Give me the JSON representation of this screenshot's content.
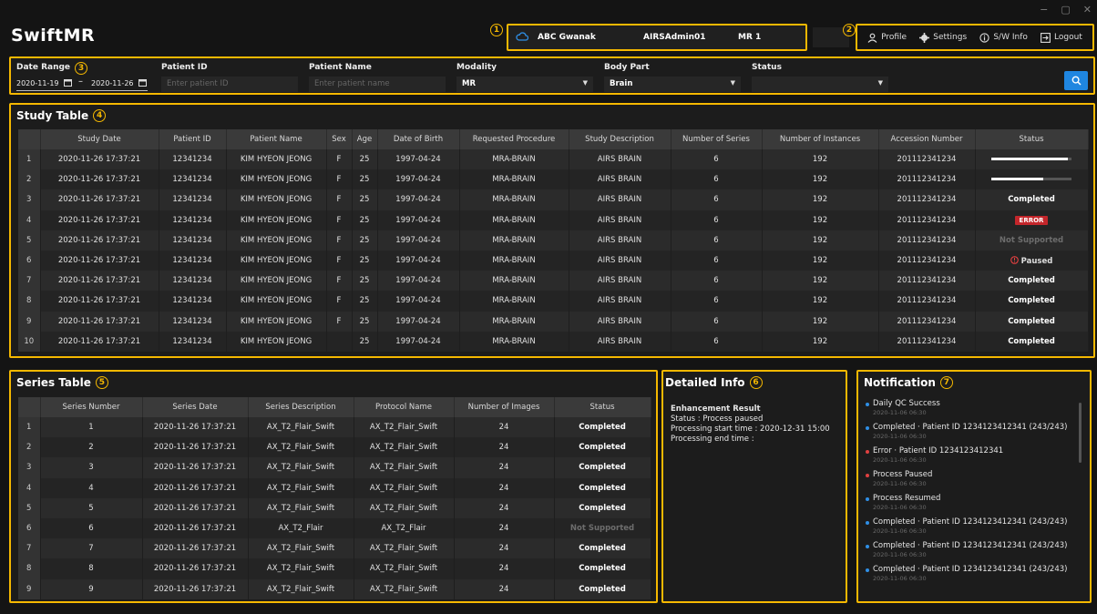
{
  "window": {
    "minimize": "−",
    "maximize": "▢",
    "close": "✕"
  },
  "app": {
    "title": "SwiftMR"
  },
  "badges": {
    "b1": "1",
    "b2": "2",
    "b3": "3",
    "b4": "4",
    "b5": "5",
    "b6": "6",
    "b7": "7"
  },
  "header": {
    "site": "ABC Gwanak",
    "user": "AIRSAdmin01",
    "device": "MR 1"
  },
  "menu": {
    "profile": "Profile",
    "settings": "Settings",
    "swinfo": "S/W Info",
    "logout": "Logout"
  },
  "filters": {
    "date_range_label": "Date Range",
    "date_from": "2020-11-19",
    "date_sep": "–",
    "date_to": "2020-11-26",
    "patient_id_label": "Patient ID",
    "patient_id_placeholder": "Enter patient ID",
    "patient_name_label": "Patient Name",
    "patient_name_placeholder": "Enter patient name",
    "modality_label": "Modality",
    "modality_value": "MR",
    "body_part_label": "Body Part",
    "body_part_value": "Brain",
    "status_label": "Status",
    "status_value": ""
  },
  "study": {
    "title": "Study Table",
    "columns": [
      "",
      "Study Date",
      "Patient ID",
      "Patient Name",
      "Sex",
      "Age",
      "Date of Birth",
      "Requested Procedure",
      "Study Description",
      "Number of Series",
      "Number of Instances",
      "Accession Number",
      "Status"
    ],
    "rows": [
      {
        "n": "1",
        "date": "2020-11-26 17:37:21",
        "pid": "12341234",
        "name": "KIM HYEON JEONG",
        "sex": "F",
        "age": "25",
        "dob": "1997-04-24",
        "proc": "MRA-BRAIN",
        "desc": "AIRS BRAIN",
        "series": "6",
        "inst": "192",
        "acc": "201112341234",
        "status": "",
        "progress": 0.95
      },
      {
        "n": "2",
        "date": "2020-11-26 17:37:21",
        "pid": "12341234",
        "name": "KIM HYEON JEONG",
        "sex": "F",
        "age": "25",
        "dob": "1997-04-24",
        "proc": "MRA-BRAIN",
        "desc": "AIRS BRAIN",
        "series": "6",
        "inst": "192",
        "acc": "201112341234",
        "status": "",
        "progress": 0.65
      },
      {
        "n": "3",
        "date": "2020-11-26 17:37:21",
        "pid": "12341234",
        "name": "KIM HYEON JEONG",
        "sex": "F",
        "age": "25",
        "dob": "1997-04-24",
        "proc": "MRA-BRAIN",
        "desc": "AIRS BRAIN",
        "series": "6",
        "inst": "192",
        "acc": "201112341234",
        "status": "Completed"
      },
      {
        "n": "4",
        "date": "2020-11-26 17:37:21",
        "pid": "12341234",
        "name": "KIM HYEON JEONG",
        "sex": "F",
        "age": "25",
        "dob": "1997-04-24",
        "proc": "MRA-BRAIN",
        "desc": "AIRS BRAIN",
        "series": "6",
        "inst": "192",
        "acc": "201112341234",
        "status": "ERROR"
      },
      {
        "n": "5",
        "date": "2020-11-26 17:37:21",
        "pid": "12341234",
        "name": "KIM HYEON JEONG",
        "sex": "F",
        "age": "25",
        "dob": "1997-04-24",
        "proc": "MRA-BRAIN",
        "desc": "AIRS BRAIN",
        "series": "6",
        "inst": "192",
        "acc": "201112341234",
        "status": "Not Supported"
      },
      {
        "n": "6",
        "date": "2020-11-26 17:37:21",
        "pid": "12341234",
        "name": "KIM HYEON JEONG",
        "sex": "F",
        "age": "25",
        "dob": "1997-04-24",
        "proc": "MRA-BRAIN",
        "desc": "AIRS BRAIN",
        "series": "6",
        "inst": "192",
        "acc": "201112341234",
        "status": "Paused"
      },
      {
        "n": "7",
        "date": "2020-11-26 17:37:21",
        "pid": "12341234",
        "name": "KIM HYEON JEONG",
        "sex": "F",
        "age": "25",
        "dob": "1997-04-24",
        "proc": "MRA-BRAIN",
        "desc": "AIRS BRAIN",
        "series": "6",
        "inst": "192",
        "acc": "201112341234",
        "status": "Completed"
      },
      {
        "n": "8",
        "date": "2020-11-26 17:37:21",
        "pid": "12341234",
        "name": "KIM HYEON JEONG",
        "sex": "F",
        "age": "25",
        "dob": "1997-04-24",
        "proc": "MRA-BRAIN",
        "desc": "AIRS BRAIN",
        "series": "6",
        "inst": "192",
        "acc": "201112341234",
        "status": "Completed"
      },
      {
        "n": "9",
        "date": "2020-11-26 17:37:21",
        "pid": "12341234",
        "name": "KIM HYEON JEONG",
        "sex": "F",
        "age": "25",
        "dob": "1997-04-24",
        "proc": "MRA-BRAIN",
        "desc": "AIRS BRAIN",
        "series": "6",
        "inst": "192",
        "acc": "201112341234",
        "status": "Completed"
      },
      {
        "n": "10",
        "date": "2020-11-26 17:37:21",
        "pid": "12341234",
        "name": "KIM HYEON JEONG",
        "sex": "",
        "age": "25",
        "dob": "1997-04-24",
        "proc": "MRA-BRAIN",
        "desc": "AIRS BRAIN",
        "series": "6",
        "inst": "192",
        "acc": "201112341234",
        "status": "Completed"
      }
    ]
  },
  "series": {
    "title": "Series Table",
    "columns": [
      "",
      "Series Number",
      "Series Date",
      "Series Description",
      "Protocol Name",
      "Number of Images",
      "Status"
    ],
    "rows": [
      {
        "n": "1",
        "num": "1",
        "date": "2020-11-26 17:37:21",
        "desc": "AX_T2_Flair_Swift",
        "proto": "AX_T2_Flair_Swift",
        "images": "24",
        "status": "Completed"
      },
      {
        "n": "2",
        "num": "2",
        "date": "2020-11-26 17:37:21",
        "desc": "AX_T2_Flair_Swift",
        "proto": "AX_T2_Flair_Swift",
        "images": "24",
        "status": "Completed"
      },
      {
        "n": "3",
        "num": "3",
        "date": "2020-11-26 17:37:21",
        "desc": "AX_T2_Flair_Swift",
        "proto": "AX_T2_Flair_Swift",
        "images": "24",
        "status": "Completed"
      },
      {
        "n": "4",
        "num": "4",
        "date": "2020-11-26 17:37:21",
        "desc": "AX_T2_Flair_Swift",
        "proto": "AX_T2_Flair_Swift",
        "images": "24",
        "status": "Completed"
      },
      {
        "n": "5",
        "num": "5",
        "date": "2020-11-26 17:37:21",
        "desc": "AX_T2_Flair_Swift",
        "proto": "AX_T2_Flair_Swift",
        "images": "24",
        "status": "Completed"
      },
      {
        "n": "6",
        "num": "6",
        "date": "2020-11-26 17:37:21",
        "desc": "AX_T2_Flair",
        "proto": "AX_T2_Flair",
        "images": "24",
        "status": "Not Supported"
      },
      {
        "n": "7",
        "num": "7",
        "date": "2020-11-26 17:37:21",
        "desc": "AX_T2_Flair_Swift",
        "proto": "AX_T2_Flair_Swift",
        "images": "24",
        "status": "Completed"
      },
      {
        "n": "8",
        "num": "8",
        "date": "2020-11-26 17:37:21",
        "desc": "AX_T2_Flair_Swift",
        "proto": "AX_T2_Flair_Swift",
        "images": "24",
        "status": "Completed"
      },
      {
        "n": "9",
        "num": "9",
        "date": "2020-11-26 17:37:21",
        "desc": "AX_T2_Flair_Swift",
        "proto": "AX_T2_Flair_Swift",
        "images": "24",
        "status": "Completed"
      }
    ]
  },
  "detail": {
    "title": "Detailed Info",
    "heading": "Enhancement Result",
    "status": "Status : Process paused",
    "start": "Processing start time : 2020-12-31 15:00",
    "end": "Processing end time :"
  },
  "notification": {
    "title": "Notification",
    "items": [
      {
        "text": "Daily QC Success",
        "date": "2020-11-06 06:30",
        "color": "#2f8fe6"
      },
      {
        "text": "Completed · Patient ID 1234123412341 (243/243)",
        "date": "2020-11-06 06:30",
        "color": "#2f8fe6"
      },
      {
        "text": "Error · Patient ID 1234123412341",
        "date": "2020-11-06 06:30",
        "color": "#e04040"
      },
      {
        "text": "Process Paused",
        "date": "2020-11-06 06:30",
        "color": "#e04040"
      },
      {
        "text": "Process Resumed",
        "date": "2020-11-06 06:30",
        "color": "#2f8fe6"
      },
      {
        "text": "Completed · Patient ID 1234123412341 (243/243)",
        "date": "2020-11-06 06:30",
        "color": "#2f8fe6"
      },
      {
        "text": "Completed · Patient ID 1234123412341 (243/243)",
        "date": "2020-11-06 06:30",
        "color": "#2f8fe6"
      },
      {
        "text": "Completed · Patient ID 1234123412341 (243/243)",
        "date": "2020-11-06 06:30",
        "color": "#2f8fe6"
      }
    ]
  },
  "colors": {
    "highlight": "#f5b800",
    "accent": "#1f86e0",
    "error": "#c4262b"
  }
}
